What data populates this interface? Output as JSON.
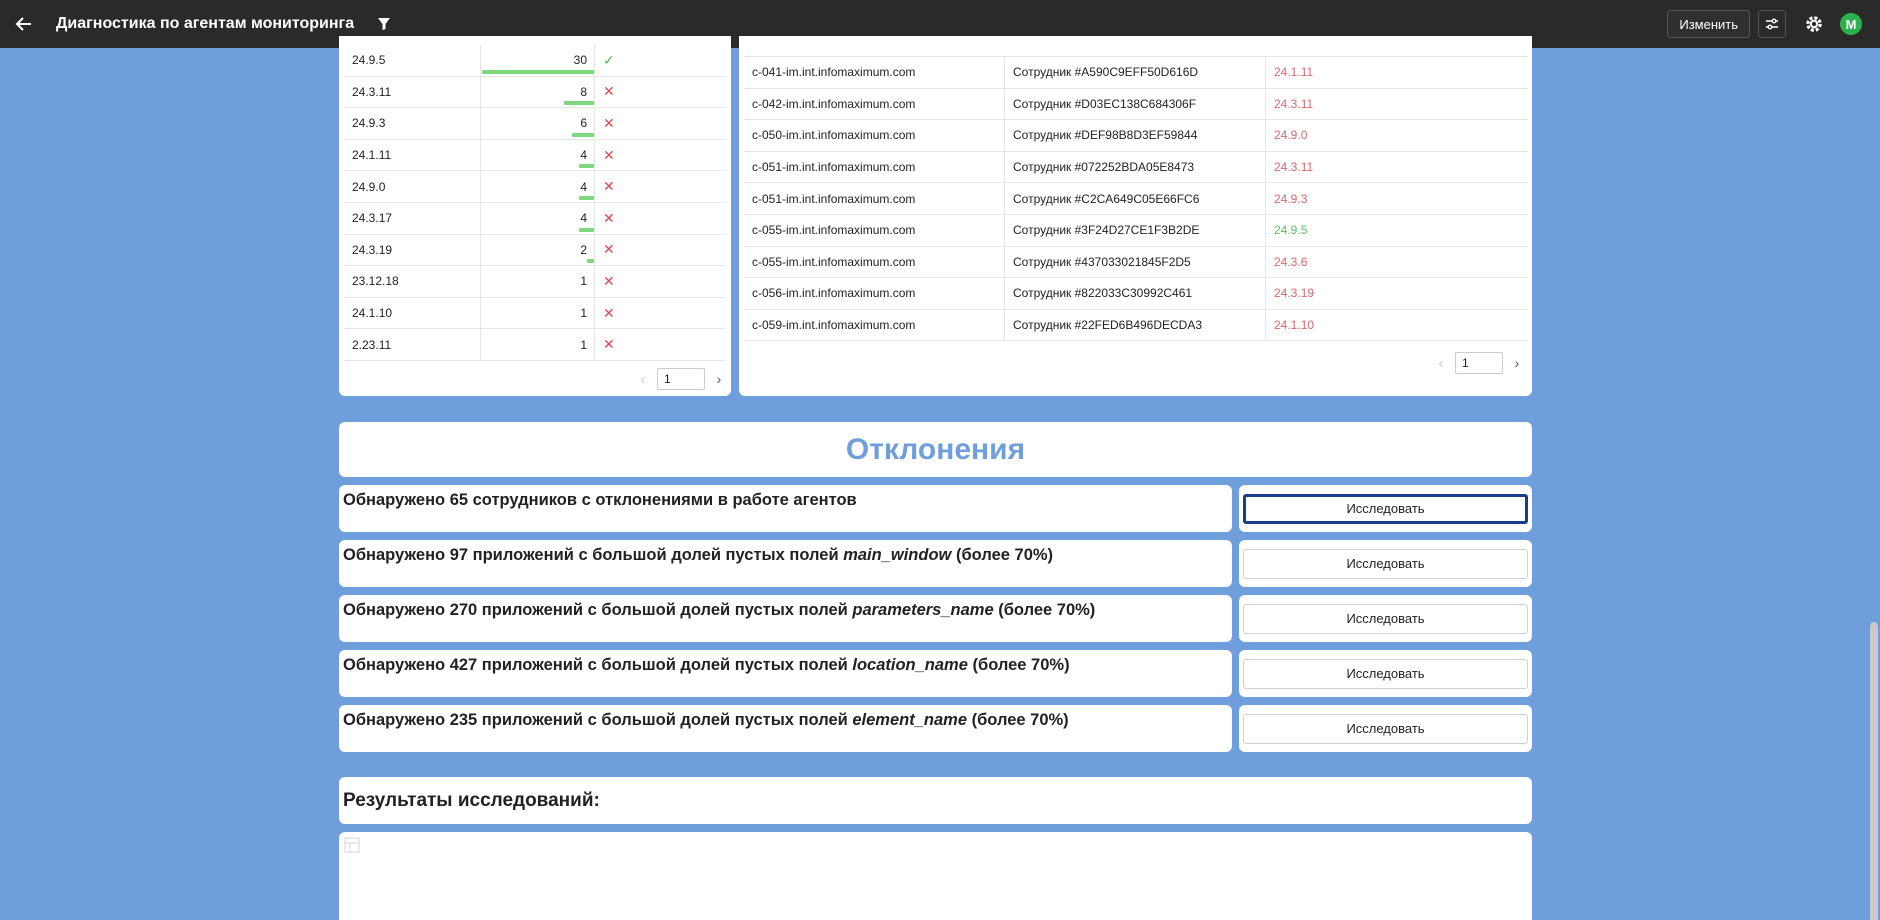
{
  "header": {
    "title": "Диагностика по агентам мониторинга",
    "edit_label": "Изменить",
    "avatar_letter": "M",
    "icons": [
      "back-arrow-icon",
      "filter-icon",
      "sliders-icon",
      "gear-icon"
    ]
  },
  "versions": {
    "rows": [
      {
        "version": "24.9.5",
        "count": "30",
        "share": 1.0,
        "status": "ok"
      },
      {
        "version": "24.3.11",
        "count": "8",
        "share": 0.2667,
        "status": "bad"
      },
      {
        "version": "24.9.3",
        "count": "6",
        "share": 0.2,
        "status": "bad"
      },
      {
        "version": "24.1.11",
        "count": "4",
        "share": 0.1333,
        "status": "bad"
      },
      {
        "version": "24.9.0",
        "count": "4",
        "share": 0.1333,
        "status": "bad"
      },
      {
        "version": "24.3.17",
        "count": "4",
        "share": 0.1333,
        "status": "bad"
      },
      {
        "version": "24.3.19",
        "count": "2",
        "share": 0.0667,
        "status": "bad"
      },
      {
        "version": "23.12.18",
        "count": "1",
        "share": 0.0,
        "status": "bad"
      },
      {
        "version": "24.1.10",
        "count": "1",
        "share": 0.0,
        "status": "bad"
      },
      {
        "version": "2.23.11",
        "count": "1",
        "share": 0.0,
        "status": "bad"
      }
    ],
    "ok_symbol": "✓",
    "bad_symbol": "✕",
    "page": "1"
  },
  "employees": {
    "rows": [
      {
        "host": "c-041-im.int.infomaximum.com",
        "employee": "Сотрудник #A590C9EFF50D616D",
        "version": "24.1.11",
        "ok": false
      },
      {
        "host": "c-042-im.int.infomaximum.com",
        "employee": "Сотрудник #D03EC138C684306F",
        "version": "24.3.11",
        "ok": false
      },
      {
        "host": "c-050-im.int.infomaximum.com",
        "employee": "Сотрудник #DEF98B8D3EF59844",
        "version": "24.9.0",
        "ok": false
      },
      {
        "host": "c-051-im.int.infomaximum.com",
        "employee": "Сотрудник #072252BDA05E8473",
        "version": "24.3.11",
        "ok": false
      },
      {
        "host": "c-051-im.int.infomaximum.com",
        "employee": "Сотрудник #C2CA649C05E66FC6",
        "version": "24.9.3",
        "ok": false
      },
      {
        "host": "c-055-im.int.infomaximum.com",
        "employee": "Сотрудник #3F24D27CE1F3B2DE",
        "version": "24.9.5",
        "ok": true
      },
      {
        "host": "c-055-im.int.infomaximum.com",
        "employee": "Сотрудник #437033021845F2D5",
        "version": "24.3.6",
        "ok": false
      },
      {
        "host": "c-056-im.int.infomaximum.com",
        "employee": "Сотрудник #822033C30992C461",
        "version": "24.3.19",
        "ok": false
      },
      {
        "host": "c-059-im.int.infomaximum.com",
        "employee": "Сотрудник #22FED6B496DECDA3",
        "version": "24.1.10",
        "ok": false
      }
    ],
    "page": "1"
  },
  "deviations": {
    "title": "Отклонения",
    "button_label": "Исследовать",
    "items": [
      {
        "prefix": "Обнаружено 65 сотрудников с отклонениями в работе агентов",
        "field": "",
        "suffix": ""
      },
      {
        "prefix": "Обнаружено 97 приложений с большой долей пустых полей ",
        "field": "main_window",
        "suffix": " (более 70%)"
      },
      {
        "prefix": "Обнаружено 270 приложений с большой долей пустых полей ",
        "field": "parameters_name",
        "suffix": " (более 70%)"
      },
      {
        "prefix": "Обнаружено 427 приложений с большой долей пустых полей ",
        "field": "location_name",
        "suffix": " (более 70%)"
      },
      {
        "prefix": "Обнаружено 235 приложений с большой долей пустых полей ",
        "field": "element_name",
        "suffix": " (более 70%)"
      }
    ]
  },
  "results": {
    "title": "Результаты исследований:"
  }
}
